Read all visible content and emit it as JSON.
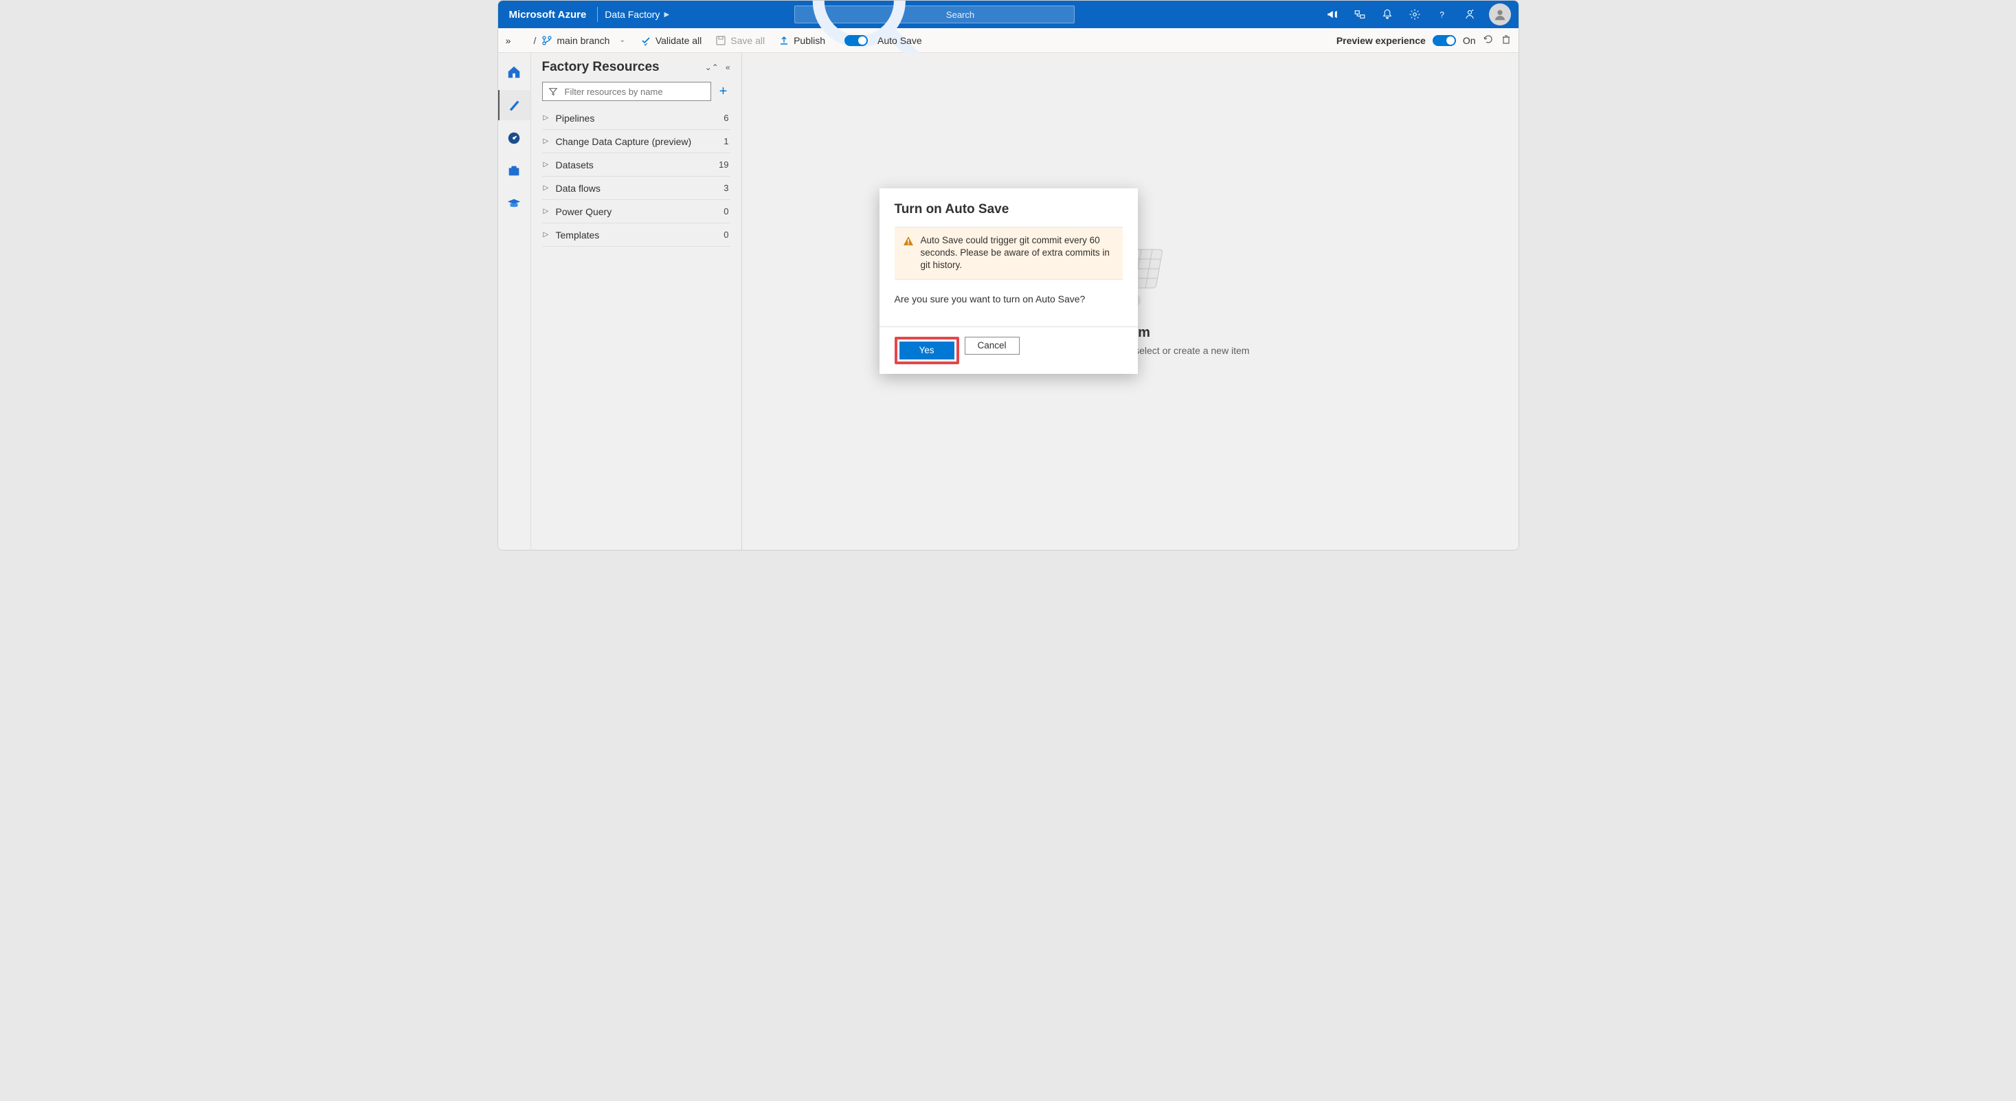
{
  "header": {
    "logo": "Microsoft Azure",
    "breadcrumb": "Data Factory",
    "search_placeholder": "Search"
  },
  "toolbar": {
    "branch": "main branch",
    "validate": "Validate all",
    "save": "Save all",
    "publish": "Publish",
    "autosave": "Auto Save",
    "preview": "Preview experience",
    "preview_state": "On"
  },
  "resources": {
    "title": "Factory Resources",
    "filter_placeholder": "Filter resources by name",
    "items": [
      {
        "label": "Pipelines",
        "count": "6"
      },
      {
        "label": "Change Data Capture (preview)",
        "count": "1"
      },
      {
        "label": "Datasets",
        "count": "19"
      },
      {
        "label": "Data flows",
        "count": "3"
      },
      {
        "label": "Power Query",
        "count": "0"
      },
      {
        "label": "Templates",
        "count": "0"
      }
    ]
  },
  "empty": {
    "title_suffix": "n item",
    "subtitle": "Use the resource explorer to select or create a new item"
  },
  "dialog": {
    "title": "Turn on Auto Save",
    "warning": "Auto Save could trigger git commit every 60 seconds. Please be aware of extra commits in git history.",
    "message": "Are you sure you want to turn on Auto Save?",
    "yes": "Yes",
    "cancel": "Cancel"
  }
}
